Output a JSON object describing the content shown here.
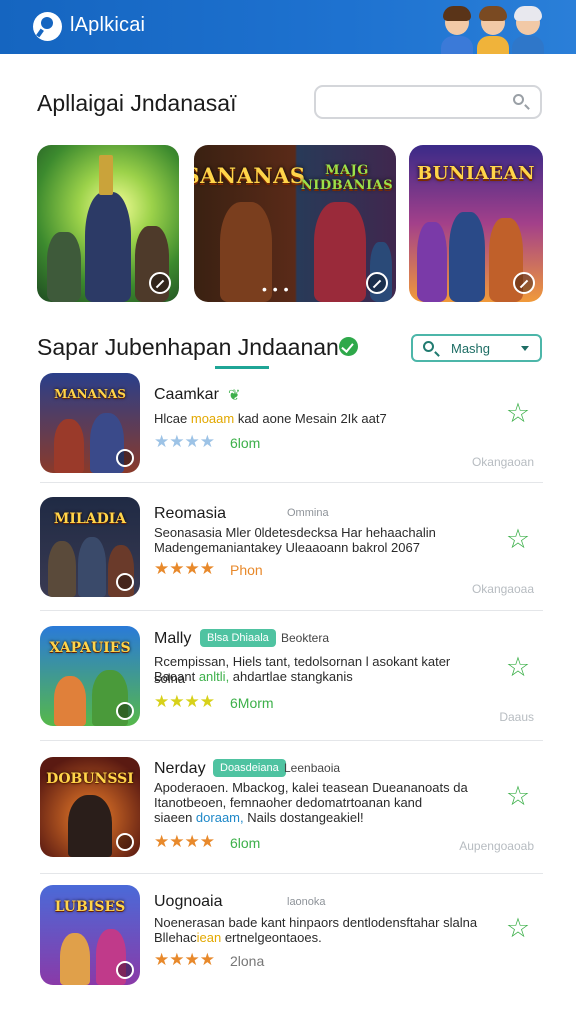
{
  "header": {
    "app_title": "lAplkicai"
  },
  "section1": {
    "title": "Apllaigai Jndanasaï",
    "search_placeholder": "",
    "banners": [
      {
        "tag": "",
        "title": ""
      },
      {
        "tag": "",
        "title": "SANANAS",
        "title2": "MAJG NIDBANIAS"
      },
      {
        "tag": "",
        "title": "BUNIAEAN"
      }
    ],
    "dots": "• • •"
  },
  "section2": {
    "title": "Sapar Jubenhapan Jndaanan",
    "filter_label": "Mashg"
  },
  "apps": [
    {
      "thumb_label": "MANANAS",
      "name": "Caamkar",
      "desc_line1_a": "Hlcae ",
      "desc_line1_hl": "moaam",
      "desc_line1_b": " kad aone Mesain 2Ik aat7",
      "desc_line2": "",
      "stars": "★★★★",
      "size": "6lom",
      "meta": "Okangaoan"
    },
    {
      "thumb_label": "MILADIA",
      "name": "Reomasia",
      "cat": "Ommina",
      "desc_line1_a": "Seonasasia Mler 0ldetesdecksa Har hehaachalin",
      "desc_line1_hl": "",
      "desc_line1_b": "",
      "desc_line2": "Madengemaniantakey Uleaaoann bakrol 2067",
      "stars": "★★★★",
      "size": "Phon",
      "meta": "Okangaoaa"
    },
    {
      "thumb_label": "XAPAUIES",
      "name": "Mally",
      "badge": "Blsa Dhiaala",
      "cat": "Beoktera",
      "desc_line1_a": "Rcempissan, Hiels tant, tedolsornan l asokant kater solna",
      "desc_line1_hl": "",
      "desc_line1_b": "",
      "desc_line2_a": "Baoant ",
      "desc_line2_hl": "anltli,",
      "desc_line2_b": " ahdartlae stangkanis",
      "stars": "★★★★",
      "size": "6Morm",
      "meta": "Daaus"
    },
    {
      "thumb_label": "DOBUNSSI",
      "name": "Nerday",
      "badge": "Doasdeiana",
      "cat": "Leenbaoia",
      "desc_line1_a": "Apoderaoen. Mbackog, kalei teasean Dueananoats da",
      "desc_line1_hl": "",
      "desc_line1_b": "",
      "desc_line2": "Itanotbeoen, femnaoher dedomatrtoanan kand",
      "desc_line3_a": "siaeen ",
      "desc_line3_hl": "doraam,",
      "desc_line3_b": " Nails dostangeakiel!",
      "stars": "★★★★",
      "size": "6lom",
      "meta": "Aupengoaoab"
    },
    {
      "thumb_label": "LUBISES",
      "name": "Uognoaia",
      "cat": "laonoka",
      "desc_line1_a": "Noenerasan bade kant hinpaors dentlodensftahar slalna",
      "desc_line1_hl": "",
      "desc_line1_b": "",
      "desc_line2_a": "Bllehac",
      "desc_line2_hl": "iean",
      "desc_line2_b": " ertnelgeontaoes.",
      "stars": "★★★★",
      "size": "2lona",
      "meta": ""
    }
  ],
  "colors": {
    "header_bg": "#1565c0",
    "accent_teal": "#1fa596",
    "verified_green": "#2ea84a",
    "star_blue": "#9dc3e6",
    "star_orange": "#e8892b",
    "star_yellow": "#d7d11a",
    "badge_green": "#4fc3a1",
    "fav_green": "#3db04a"
  },
  "icons": {
    "logo": "search-logo-icon",
    "search": "search-icon",
    "verified": "verified-check-icon",
    "filter": "search-icon",
    "dropdown": "chevron-down-icon",
    "favorite": "star-outline-icon",
    "open": "open-link-icon"
  }
}
